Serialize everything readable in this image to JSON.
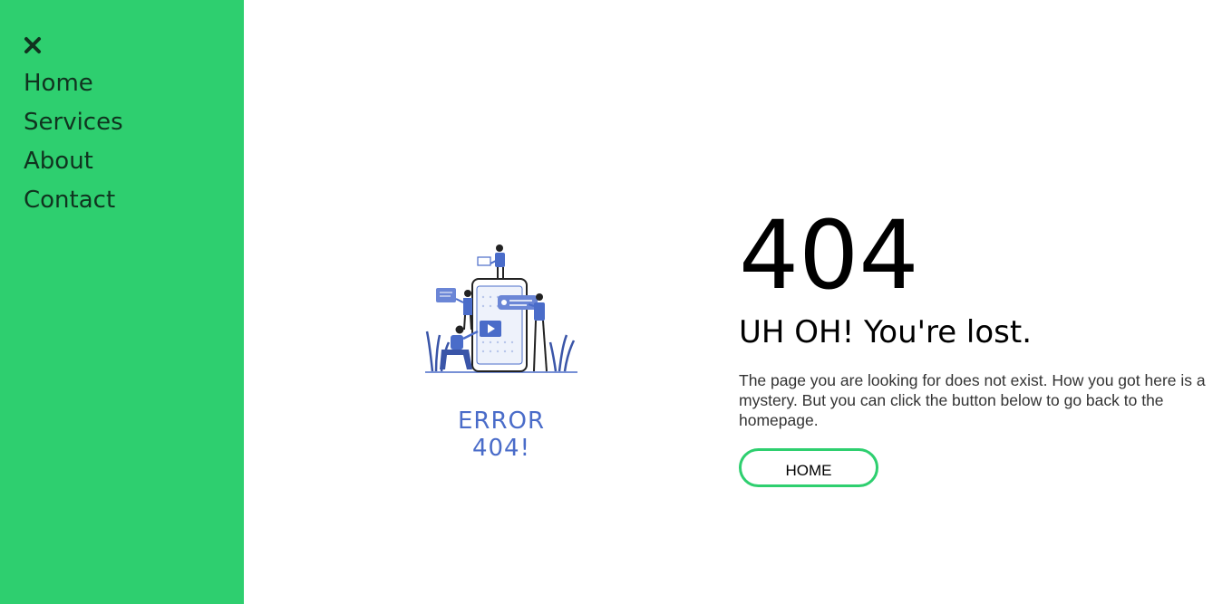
{
  "sidebar": {
    "background_color": "#2ecf6f",
    "close_icon": "close-icon",
    "items": [
      {
        "label": "Home"
      },
      {
        "label": "Services"
      },
      {
        "label": "About"
      },
      {
        "label": "Contact"
      }
    ]
  },
  "illustration": {
    "caption": "ERROR 404!",
    "caption_color": "#4a6cc9",
    "accent_color": "#4a6cc9"
  },
  "error": {
    "code": "404",
    "title": "UH OH! You're lost.",
    "description": "The page you are looking for does not exist. How you got here is a mystery. But you can click the button below to go back to the homepage.",
    "button_label": "HOME",
    "button_border_color": "#2ecf6f"
  }
}
